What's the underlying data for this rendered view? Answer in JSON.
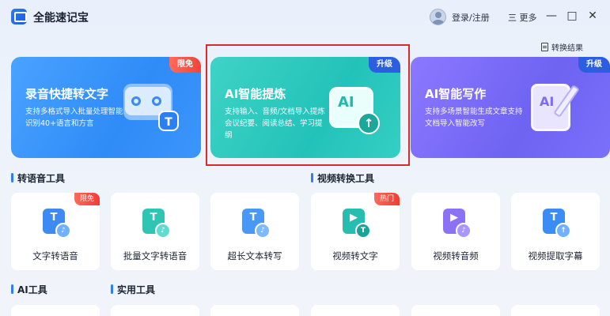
{
  "app": {
    "title": "全能速记宝"
  },
  "header": {
    "login_label": "登录/注册",
    "more_label": "三 更多",
    "minimize_glyph": "—",
    "maximize_glyph": "□",
    "close_glyph": "✕"
  },
  "toolbar": {
    "convert_result_label": "转换结果"
  },
  "cards": [
    {
      "title": "录音快捷转文字",
      "desc": "支持多格式导入批量处理智能识别40+语言和方言",
      "tag": "限免",
      "icon": "cassette-text-icon"
    },
    {
      "title": "AI智能提炼",
      "desc": "支持输入、音频/文档导入提炼会议纪要、阅读总结、学习提纲",
      "tag": "升级",
      "icon": "ai-screen-upload-icon"
    },
    {
      "title": "AI智能写作",
      "desc": "支持多场景智能生成文章支持文档导入智能改写",
      "tag": "升级",
      "icon": "ai-document-pen-icon"
    }
  ],
  "sections": {
    "speech": "转语音工具",
    "video": "视频转换工具",
    "ai": "AI工具",
    "utility": "实用工具"
  },
  "tools": [
    {
      "label": "文字转语音",
      "badge": "限免",
      "icon": "text-to-speech-icon"
    },
    {
      "label": "批量文字转语音",
      "badge": "",
      "icon": "batch-text-to-speech-icon"
    },
    {
      "label": "超长文本转写",
      "badge": "",
      "icon": "long-text-to-speech-icon"
    },
    {
      "label": "视频转文字",
      "badge": "热门",
      "icon": "video-to-text-icon"
    },
    {
      "label": "视频转音频",
      "badge": "",
      "icon": "video-to-audio-icon"
    },
    {
      "label": "视频提取字幕",
      "badge": "",
      "icon": "video-subtitle-icon"
    }
  ],
  "colors": {
    "accent": "#2f7ff2",
    "highlight": "#d92b2b",
    "badge_red": "#f2443a"
  }
}
